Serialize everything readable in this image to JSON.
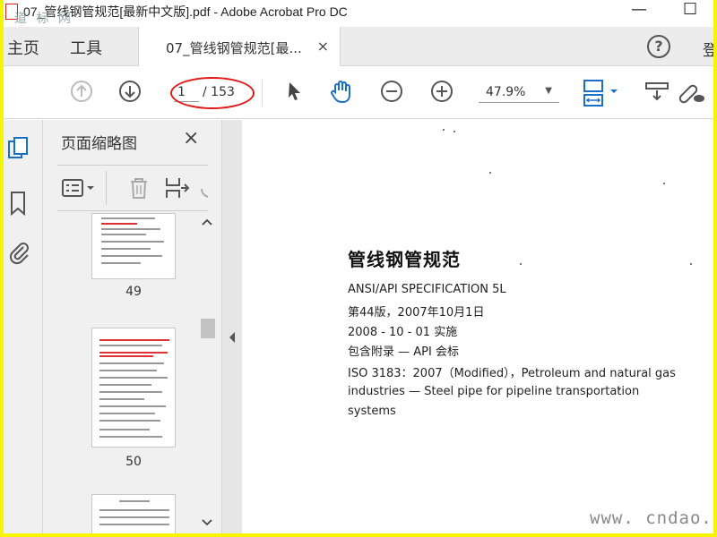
{
  "window": {
    "title": "07_管线钢管规范[最新中文版].pdf - Adobe Acrobat Pro DC",
    "minimize_glyph": "—",
    "maximize_glyph": "☐",
    "watermark_top": "道 标 网"
  },
  "menu": {
    "home": "主页",
    "tools": "工具",
    "tab_label": "07_管线钢管规范[最...",
    "tab_close": "×",
    "help_glyph": "?",
    "login_stub": "登"
  },
  "toolbar": {
    "current_page": "1",
    "page_total": "/ 153",
    "zoom": "47.9%",
    "zoom_caret": "▼"
  },
  "panel": {
    "title": "页面缩略图",
    "close": "×",
    "thumbnails": [
      {
        "label": "49"
      },
      {
        "label": "50"
      },
      {
        "label": ""
      }
    ]
  },
  "document": {
    "heading": "管线钢管规范",
    "lines": [
      "ANSI/API SPECIFICATION 5L",
      "第44版，2007年10月1日",
      "2008 - 10 - 01 实施",
      "包含附录 — API 会标",
      "ISO 3183：2007（Modified），Petroleum and natural gas",
      "industries — Steel pipe for pipeline transportation",
      "systems"
    ],
    "watermark": "www. cndao. com"
  },
  "colors": {
    "frame_border": "#f5f500",
    "highlight_circle": "#e01818",
    "acrobat_blue": "#1a6fc9",
    "gray_icon": "#777777"
  }
}
